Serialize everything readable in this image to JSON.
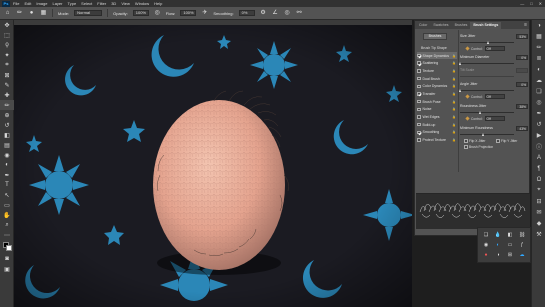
{
  "app": {
    "logo": "Ps"
  },
  "menu": [
    "File",
    "Edit",
    "Image",
    "Layer",
    "Type",
    "Select",
    "Filter",
    "3D",
    "View",
    "Window",
    "Help"
  ],
  "window_controls": [
    "—",
    "□",
    "✕"
  ],
  "options_bar": {
    "mode_label": "Mode:",
    "mode_value": "Normal",
    "opacity_label": "Opacity:",
    "opacity_value": "100%",
    "flow_label": "Flow:",
    "flow_value": "100%",
    "smoothing_label": "Smoothing:",
    "smoothing_value": "0%"
  },
  "panel": {
    "tabs": [
      "Color",
      "Swatches",
      "Brushes",
      "Brush Settings"
    ],
    "active_tab": "Brush Settings",
    "brushes_button": "Brushes",
    "left_header": "Brush Tip Shape",
    "options": [
      {
        "label": "Shape Dynamics",
        "checked": true,
        "selected": true
      },
      {
        "label": "Scattering",
        "checked": true,
        "selected": false
      },
      {
        "label": "Texture",
        "checked": false,
        "selected": false
      },
      {
        "label": "Dual Brush",
        "checked": false,
        "selected": false
      },
      {
        "label": "Color Dynamics",
        "checked": false,
        "selected": false
      },
      {
        "label": "Transfer",
        "checked": true,
        "selected": false
      },
      {
        "label": "Brush Pose",
        "checked": false,
        "selected": false
      },
      {
        "label": "Noise",
        "checked": false,
        "selected": false
      },
      {
        "label": "Wet Edges",
        "checked": false,
        "selected": false
      },
      {
        "label": "Build-up",
        "checked": false,
        "selected": false
      },
      {
        "label": "Smoothing",
        "checked": true,
        "selected": false
      },
      {
        "label": "Protect Texture",
        "checked": false,
        "selected": false
      }
    ],
    "size_jitter": {
      "label": "Size Jitter",
      "value": "53%",
      "fraction": 0.53
    },
    "size_control": {
      "label": "Control:",
      "value": "Off"
    },
    "min_diameter": {
      "label": "Minimum Diameter",
      "value": "0%",
      "fraction": 0.0
    },
    "tilt_scale": {
      "label": "Tilt Scale",
      "value": ""
    },
    "angle_jitter": {
      "label": "Angle Jitter",
      "value": "0%",
      "fraction": 0.0
    },
    "angle_control": {
      "label": "Control:",
      "value": "Off"
    },
    "roundness_jitter": {
      "label": "Roundness Jitter",
      "value": "38%",
      "fraction": 0.38
    },
    "roundness_control": {
      "label": "Control:",
      "value": "Off"
    },
    "min_roundness": {
      "label": "Minimum Roundness",
      "value": "43%",
      "fraction": 0.43
    },
    "flip_x": {
      "label": "Flip X Jitter",
      "checked": false
    },
    "flip_y": {
      "label": "Flip Y Jitter",
      "checked": false
    },
    "brush_projection": {
      "label": "Brush Projection",
      "checked": false
    }
  },
  "icons": {
    "move": "✥",
    "marquee": "⬚",
    "lasso": "ϙ",
    "wand": "✦",
    "crop": "⌗",
    "frame": "⊠",
    "eyedropper": "✎",
    "heal": "✚",
    "brush": "✏",
    "stamp": "⊕",
    "history": "↺",
    "eraser": "◧",
    "gradient": "▤",
    "blur": "◉",
    "dodge": "◐",
    "pen": "✒",
    "type": "T",
    "path": "↖",
    "shape": "▭",
    "hand": "✋",
    "zoom": "⌕",
    "more": "⋯"
  },
  "colors": {
    "accent": "#31a8ff",
    "panel_bg": "#535353",
    "chrome": "#323232",
    "fabric": "#1b1b22",
    "motif": "#2f9bd3",
    "egg_base": "#e4a38e"
  }
}
